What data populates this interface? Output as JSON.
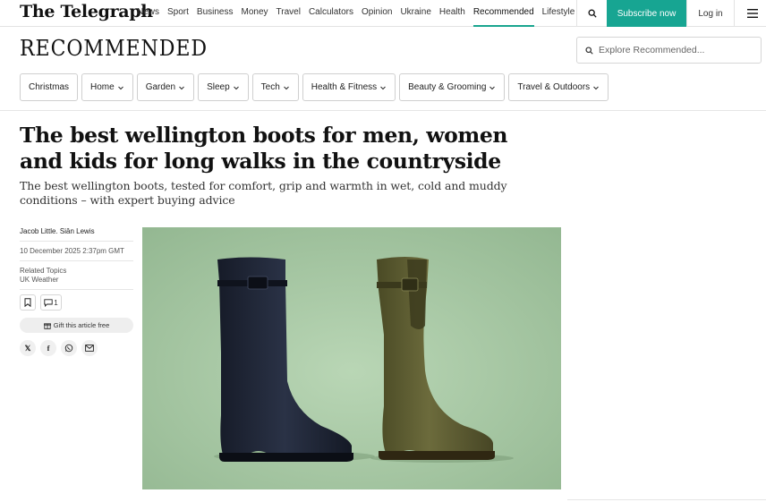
{
  "brand": {
    "logo": "The Telegraph",
    "accent": "#17a592"
  },
  "nav": {
    "items": [
      "News",
      "Sport",
      "Business",
      "Money",
      "Travel",
      "Calculators",
      "Opinion",
      "Ukraine",
      "Health",
      "Recommended",
      "Lifestyle"
    ],
    "active": "Recommended",
    "subscribe_label": "Subscribe now",
    "login_label": "Log in",
    "search_icon": "search-icon",
    "menu_icon": "hamburger-icon"
  },
  "section": {
    "title": "RECOMMENDED",
    "search_placeholder": "Explore Recommended..."
  },
  "categories": [
    {
      "label": "Christmas",
      "dropdown": false
    },
    {
      "label": "Home",
      "dropdown": true
    },
    {
      "label": "Garden",
      "dropdown": true
    },
    {
      "label": "Sleep",
      "dropdown": true
    },
    {
      "label": "Tech",
      "dropdown": true
    },
    {
      "label": "Health & Fitness",
      "dropdown": true
    },
    {
      "label": "Beauty & Grooming",
      "dropdown": true
    },
    {
      "label": "Travel & Outdoors",
      "dropdown": true
    }
  ],
  "article": {
    "headline": "The best wellington boots for men, women and kids for long walks in the countryside",
    "standfirst": "The best wellington boots, tested for comfort, grip and warmth in wet, cold and muddy conditions – with expert buying advice",
    "authors": "Jacob Little.  Siân Lewis",
    "date": "10 December 2025 2:37pm GMT",
    "related_label": "Related Topics",
    "related_topic": "UK Weather",
    "comment_count": "1",
    "gift_label": "Gift this article free",
    "share_icons": [
      "x-icon",
      "facebook-icon",
      "whatsapp-icon",
      "email-icon"
    ]
  },
  "hero": {
    "background": "#a9c9a6",
    "boot_left_color": "#1e2433",
    "boot_right_color": "#5b5a33"
  }
}
